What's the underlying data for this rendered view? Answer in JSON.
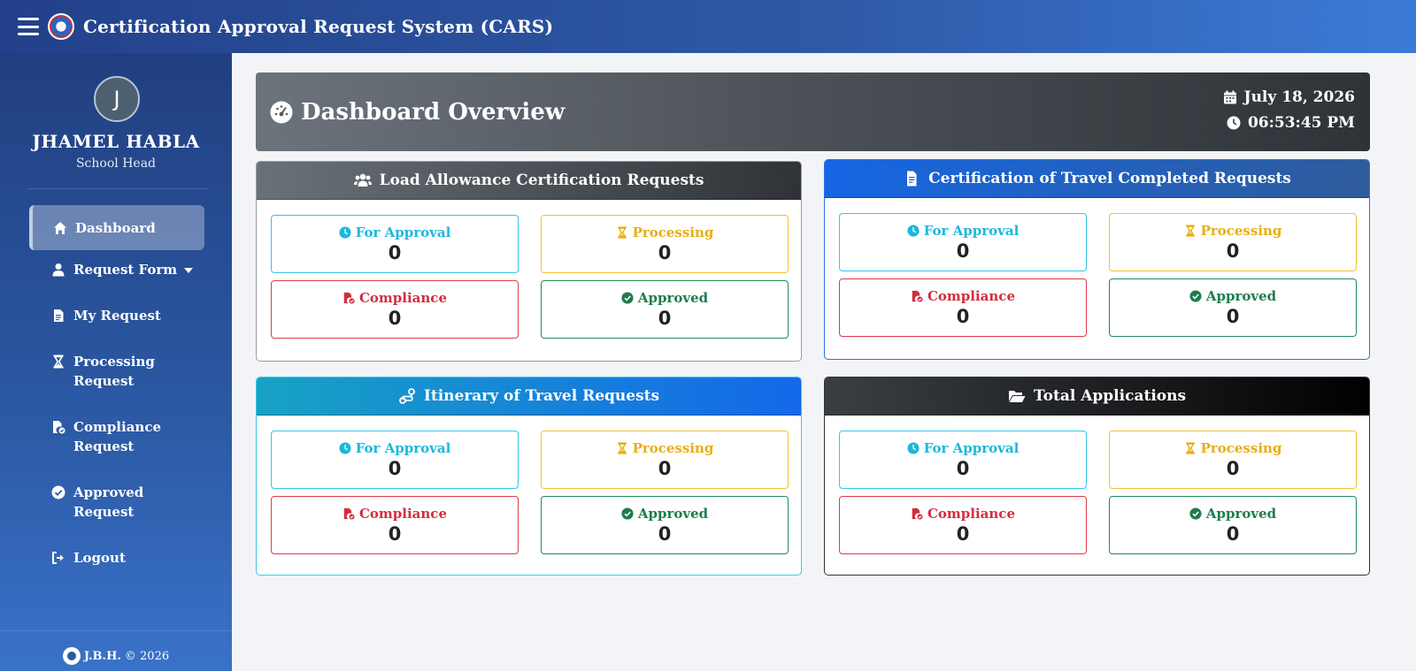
{
  "app": {
    "title": "Certification Approval Request System (CARS)"
  },
  "user": {
    "initial": "J",
    "name": "JHAMEL HABLA",
    "role": "School Head"
  },
  "nav": [
    {
      "label": "Dashboard",
      "icon": "home-icon"
    },
    {
      "label": "Request Form",
      "icon": "user-icon"
    },
    {
      "label": "My Request",
      "icon": "document-icon"
    },
    {
      "label": "Processing Request",
      "icon": "hourglass-icon"
    },
    {
      "label": "Compliance Request",
      "icon": "file-check-icon"
    },
    {
      "label": "Approved Request",
      "icon": "check-circle-icon"
    },
    {
      "label": "Logout",
      "icon": "logout-icon"
    }
  ],
  "footer": {
    "brand": "J.B.H.",
    "copyright": "© 2026"
  },
  "overview": {
    "title": "Dashboard Overview",
    "date": "July 18, 2026",
    "time": "06:53:45 PM"
  },
  "status_labels": {
    "for_approval": "For Approval",
    "processing": "Processing",
    "compliance": "Compliance",
    "approved": "Approved"
  },
  "cards": [
    {
      "title": "Load Allowance Certification Requests",
      "for_approval": "0",
      "processing": "0",
      "compliance": "0",
      "approved": "0"
    },
    {
      "title": "Certification of Travel Completed Requests",
      "for_approval": "0",
      "processing": "0",
      "compliance": "0",
      "approved": "0"
    },
    {
      "title": "Itinerary of Travel Requests",
      "for_approval": "0",
      "processing": "0",
      "compliance": "0",
      "approved": "0"
    },
    {
      "title": "Total Applications",
      "for_approval": "0",
      "processing": "0",
      "compliance": "0",
      "approved": "0"
    }
  ],
  "colors": {
    "for_approval": "#1db7dc",
    "processing": "#e9ad0f",
    "compliance": "#d22e3e",
    "approved": "#1e7c4f",
    "sidebar": "#2c5aa5"
  }
}
